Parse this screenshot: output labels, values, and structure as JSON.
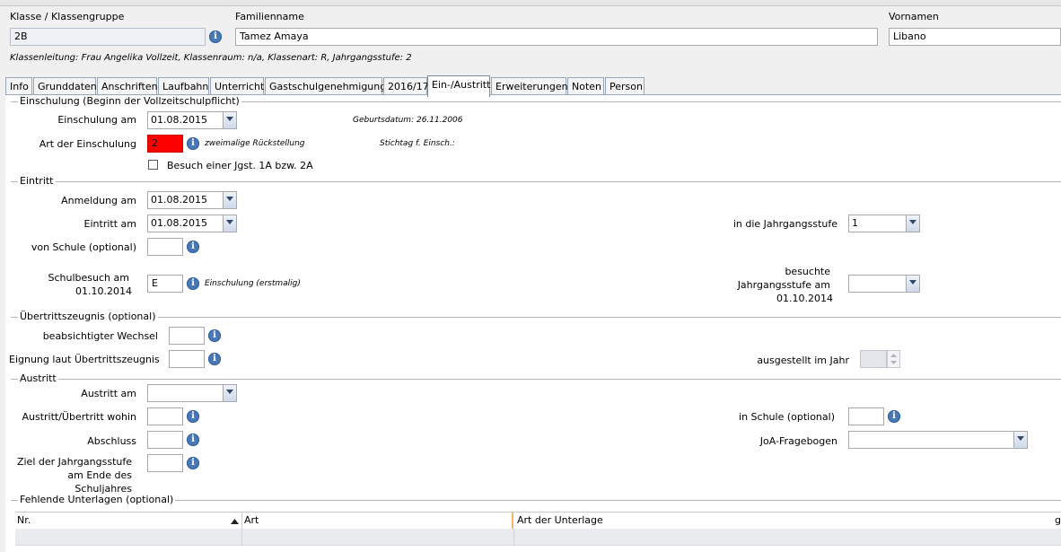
{
  "header": {
    "klasse_label": "Klasse / Klassengruppe",
    "klasse_value": "2B",
    "familienname_label": "Familienname",
    "familienname_value": "Tamez Amaya",
    "vornamen_label": "Vornamen",
    "vornamen_value": "Libano",
    "info_line": "Klassenleitung: Frau Angelika Vollzeit, Klassenraum: n/a, Klassenart: R, Jahrgangsstufe: 2"
  },
  "tabs": [
    {
      "label": "Info"
    },
    {
      "label": "Grunddaten"
    },
    {
      "label": "Anschriften"
    },
    {
      "label": "Laufbahn"
    },
    {
      "label": "Unterricht"
    },
    {
      "label": "Gastschulgenehmigung"
    },
    {
      "label": "2016/17"
    },
    {
      "label": "Ein-/Austritt"
    },
    {
      "label": "Erweiterungen"
    },
    {
      "label": "Noten"
    },
    {
      "label": "Person"
    }
  ],
  "active_tab": "Ein-/Austritt",
  "einschulung": {
    "title": "Einschulung (Beginn der Vollzeitschulpflicht)",
    "einschulung_am_label": "Einschulung am",
    "einschulung_am_value": "01.08.2015",
    "geburtsdatum": "Geburtsdatum: 26.11.2006",
    "art_label": "Art der Einschulung",
    "art_value": "2",
    "art_desc": "zweimalige Rückstellung",
    "stichtag": "Stichtag f. Einsch.:",
    "besuch_label": "Besuch einer Jgst. 1A bzw. 2A",
    "besuch_checked": false
  },
  "eintritt": {
    "title": "Eintritt",
    "anmeldung_label": "Anmeldung am",
    "anmeldung_value": "01.08.2015",
    "eintritt_label": "Eintritt am",
    "eintritt_value": "01.08.2015",
    "jgst_label": "in die Jahrgangsstufe",
    "jgst_value": "1",
    "von_schule_label": "von Schule (optional)",
    "von_schule_value": "",
    "schulbesuch_label_1": "Schulbesuch am",
    "schulbesuch_label_2": "01.10.2014",
    "schulbesuch_value": "E",
    "schulbesuch_desc": "Einschulung (erstmalig)",
    "besuchte_label_1": "besuchte",
    "besuchte_label_2": "Jahrgangsstufe am",
    "besuchte_label_3": "01.10.2014",
    "besuchte_value": ""
  },
  "uebertritt": {
    "title": "Übertrittszeugnis (optional)",
    "wechsel_label": "beabsichtigter Wechsel",
    "wechsel_value": "",
    "eignung_label": "Eignung laut Übertrittszeugnis",
    "eignung_value": "",
    "ausgestellt_label": "ausgestellt im Jahr",
    "ausgestellt_value": ""
  },
  "austritt": {
    "title": "Austritt",
    "austritt_am_label": "Austritt am",
    "austritt_am_value": "",
    "wohin_label": "Austritt/Übertritt wohin",
    "wohin_value": "",
    "in_schule_label": "in Schule (optional)",
    "in_schule_value": "",
    "abschluss_label": "Abschluss",
    "abschluss_value": "",
    "joa_label": "JoA-Fragebogen",
    "joa_value": "",
    "ziel_label_1": "Ziel der Jahrgangsstufe",
    "ziel_label_2": "am Ende des",
    "ziel_label_3": "Schuljahres",
    "ziel_value": ""
  },
  "unterlagen": {
    "title": "Fehlende Unterlagen (optional)",
    "columns": [
      "Nr.",
      "Art",
      "Art der Unterlage",
      "g"
    ]
  },
  "colors": {
    "info_icon": "#4a78b5",
    "error_field": "#ff0000",
    "active_tab_bg": "#ffffff",
    "window_bg": "#f0f0f0"
  }
}
